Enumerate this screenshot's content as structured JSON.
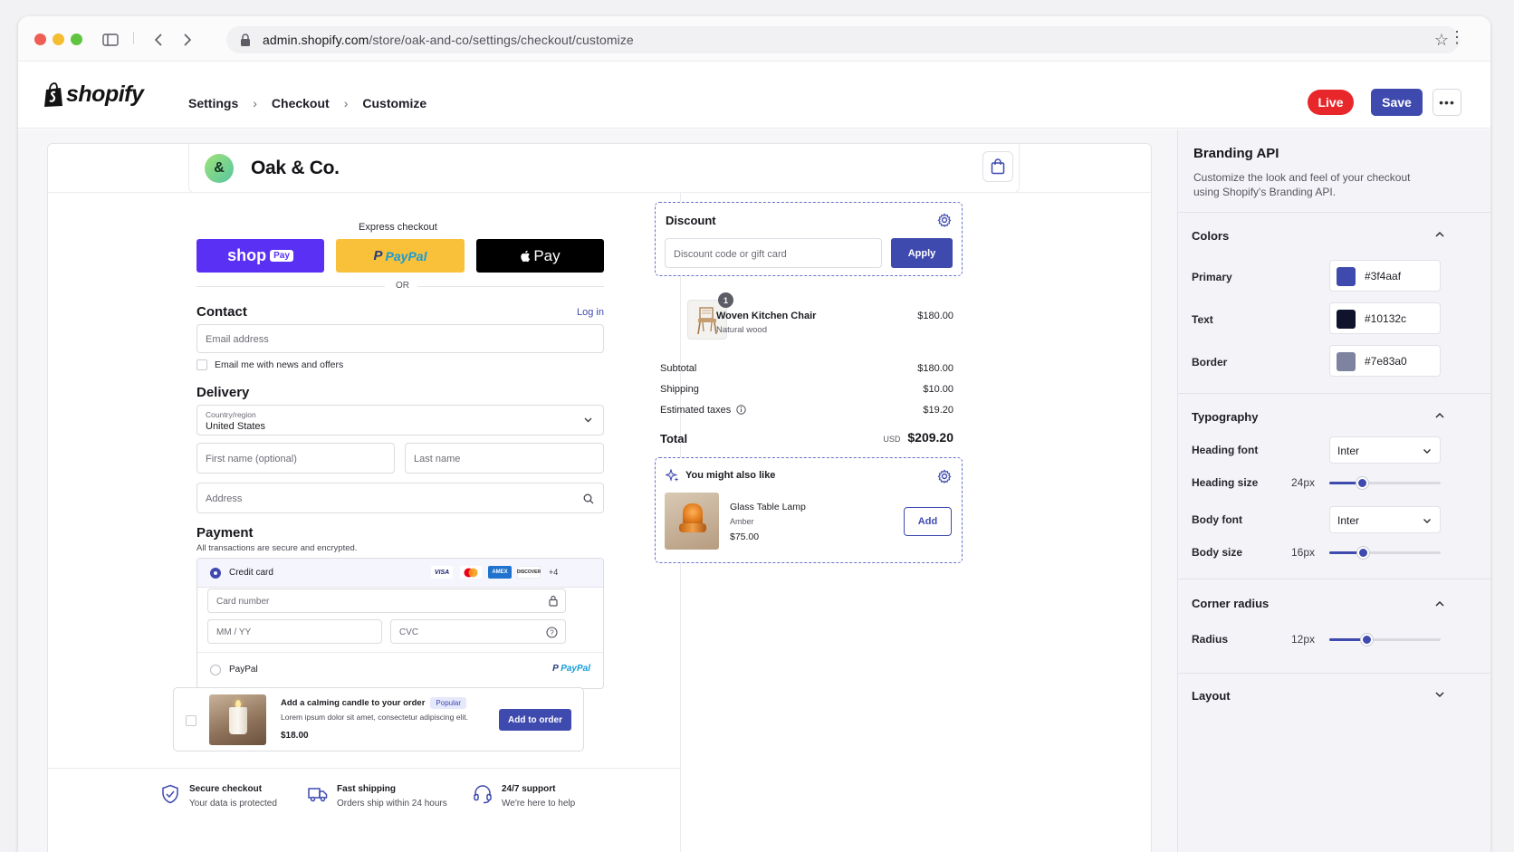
{
  "browser": {
    "url_host": "admin.shopify.com",
    "url_path": "/store/oak-and-co/settings/checkout/customize"
  },
  "header": {
    "logo_text": "shopify",
    "breadcrumbs": [
      "Settings",
      "Checkout",
      "Customize"
    ],
    "live_label": "Live",
    "save_label": "Save"
  },
  "store": {
    "logo_char": "&",
    "name": "Oak & Co."
  },
  "checkout": {
    "express_label": "Express checkout",
    "shoppay_label": "shop",
    "shoppay_badge": "Pay",
    "paypal_label": "PayPal",
    "applepay_label": "Pay",
    "or_label": "OR",
    "contact_title": "Contact",
    "login_link": "Log in",
    "email_placeholder": "Email address",
    "newsletter_label": "Email me with news and offers",
    "delivery_title": "Delivery",
    "country_label": "Country/region",
    "country_value": "United States",
    "first_name_placeholder": "First name (optional)",
    "last_name_placeholder": "Last name",
    "address_placeholder": "Address",
    "payment_title": "Payment",
    "payment_subtitle": "All transactions are secure and encrypted.",
    "credit_card_label": "Credit card",
    "card_brands": [
      "VISA",
      "",
      "AMEX",
      "DISCOVER"
    ],
    "card_more": "+4",
    "card_number_placeholder": "Card number",
    "expiry_placeholder": "MM / YY",
    "cvc_placeholder": "CVC",
    "paypal_option_label": "PayPal",
    "paypal_option_logo": "PayPal",
    "upsell": {
      "title": "Add a calming candle to your order",
      "badge": "Popular",
      "description": "Lorem ipsum dolor sit amet, consectetur adipiscing elit.",
      "price": "$18.00",
      "button": "Add to order"
    },
    "trust": [
      {
        "icon": "shield-check-icon",
        "title": "Secure checkout",
        "subtitle": "Your data is protected"
      },
      {
        "icon": "truck-icon",
        "title": "Fast shipping",
        "subtitle": "Orders ship within 24 hours"
      },
      {
        "icon": "headset-icon",
        "title": "24/7 support",
        "subtitle": "We're here to help"
      }
    ]
  },
  "summary": {
    "discount_title": "Discount",
    "discount_placeholder": "Discount code or gift card",
    "apply_label": "Apply",
    "item": {
      "name": "Woven Kitchen Chair",
      "variant": "Natural wood",
      "price": "$180.00",
      "quantity": "1"
    },
    "subtotal_label": "Subtotal",
    "subtotal": "$180.00",
    "shipping_label": "Shipping",
    "shipping": "$10.00",
    "taxes_label": "Estimated taxes",
    "taxes": "$19.20",
    "total_label": "Total",
    "currency": "USD",
    "total": "$209.20",
    "recommend_title": "You might also like",
    "recommend": {
      "name": "Glass Table Lamp",
      "variant": "Amber",
      "price": "$75.00",
      "button": "Add"
    }
  },
  "sidebar": {
    "title": "Branding API",
    "description": "Customize the look and feel of your checkout using Shopify's Branding API.",
    "colors_title": "Colors",
    "colors": [
      {
        "label": "Primary",
        "hex": "#3f4aaf"
      },
      {
        "label": "Text",
        "hex": "#10132c"
      },
      {
        "label": "Border",
        "hex": "#7e83a0"
      }
    ],
    "typography_title": "Typography",
    "heading_font_label": "Heading font",
    "heading_font": "Inter",
    "heading_size_label": "Heading size",
    "heading_size": "24px",
    "heading_size_level": 0.29,
    "body_font_label": "Body font",
    "body_font": "Inter",
    "body_size_label": "Body size",
    "body_size": "16px",
    "body_size_level": 0.3,
    "corner_title": "Corner radius",
    "radius_label": "Radius",
    "radius": "12px",
    "radius_level": 0.33,
    "layout_title": "Layout"
  },
  "colors": {
    "accent": "#3f4aaf",
    "live": "#e8272b",
    "shoppay": "#5a31f4",
    "paypal_yellow": "#f9c03a"
  }
}
